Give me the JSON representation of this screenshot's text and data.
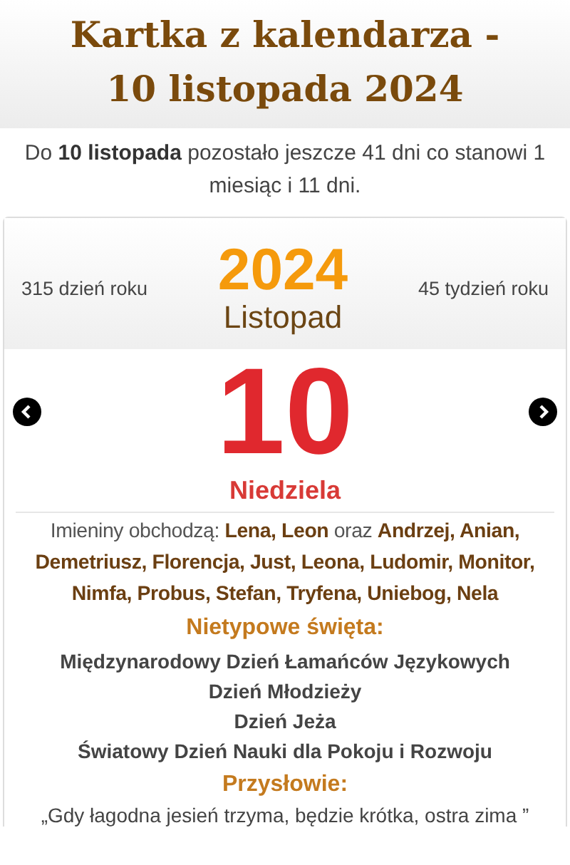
{
  "title": "Kartka z kalendarza - 10 listopada 2024",
  "countdown": "Do **10 listopada** pozostało jeszcze 41 dni co stanowi 1 miesiąc i 11 dni.",
  "card": {
    "day_of_year": "315 dzień roku",
    "year": "2024",
    "month": "Listopad",
    "week_of_year": "45 tydzień roku",
    "day": "10",
    "weekday": "Niedziela",
    "nameday": "Imieniny obchodzą: **Lena, Leon**  oraz  **Andrzej, Anian, Demetriusz, Florencja, Just, Leona, Ludomir, Monitor, Nimfa, Probus, Stefan, Tryfena, Uniebog, Nela**",
    "holidays_heading": "Nietypowe święta:",
    "holidays": [
      "Międzynarodowy Dzień Łamańców Językowych",
      "Dzień Młodzieży",
      "Dzień Jeża",
      "Światowy Dzień Nauki dla Pokoju i Rozwoju"
    ],
    "proverb_heading": "Przysłowie:",
    "proverb": "„Gdy łagodna jesień trzyma, będzie krótka, ostra zima ”"
  }
}
